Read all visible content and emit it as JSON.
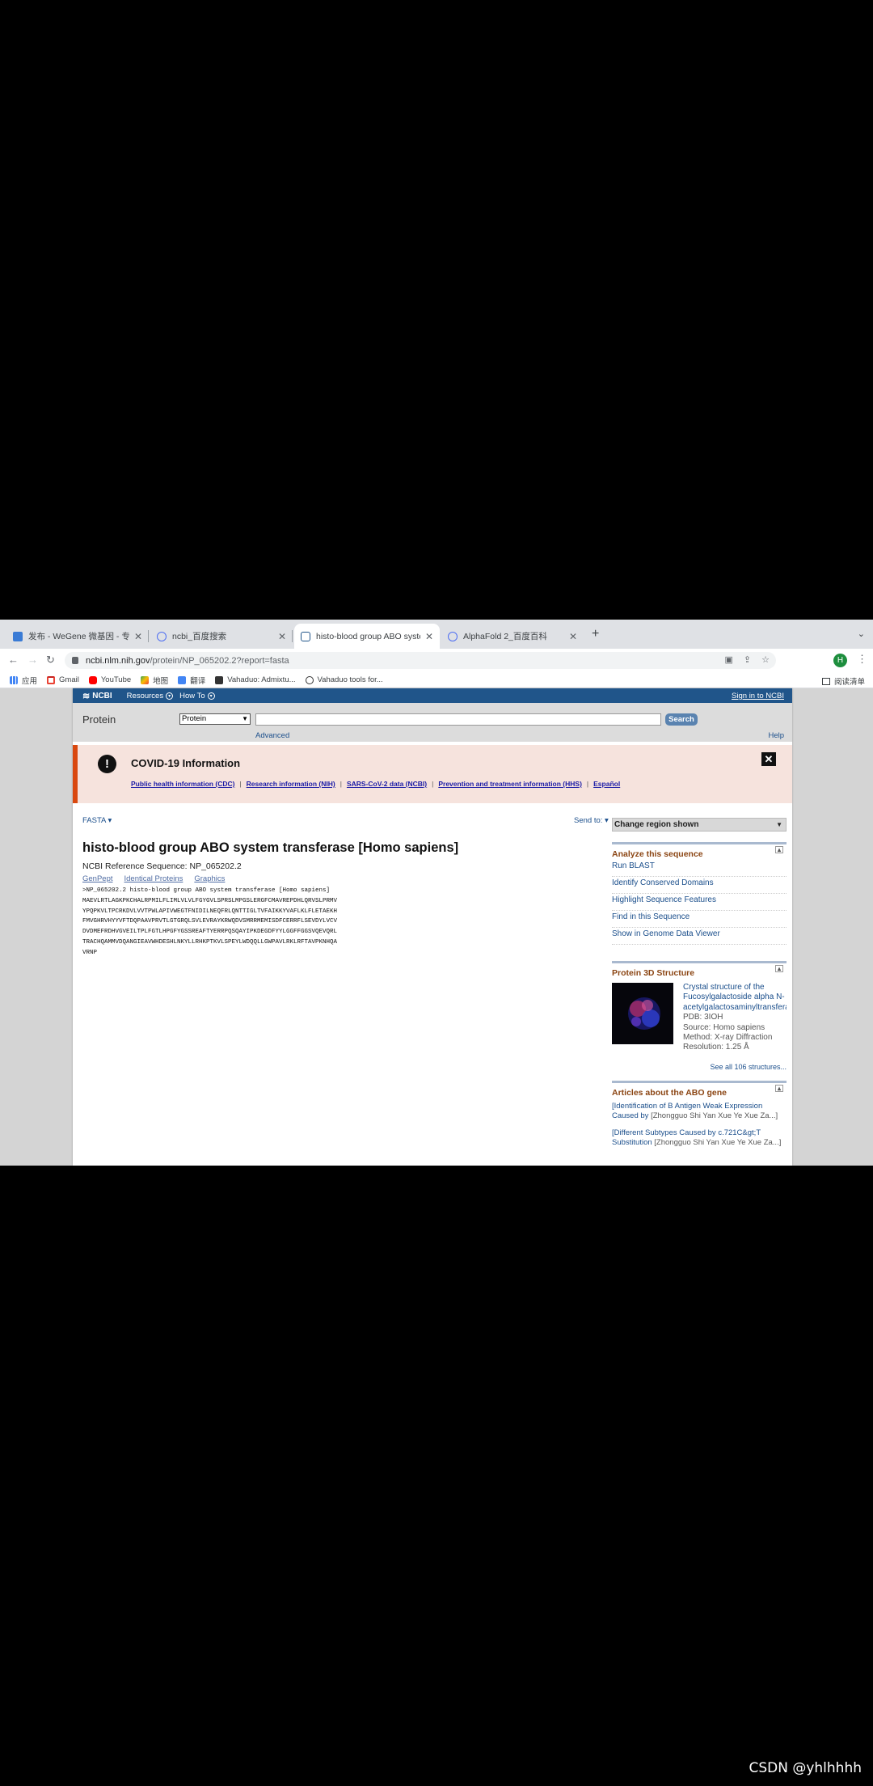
{
  "browser": {
    "tabs": [
      {
        "title": "发布 - WeGene 微基因 - 专注个",
        "active": false
      },
      {
        "title": "ncbi_百度搜索",
        "active": false
      },
      {
        "title": "histo-blood group ABO systen",
        "active": true
      },
      {
        "title": "AlphaFold 2_百度百科",
        "active": false
      }
    ],
    "url_host": "ncbi.nlm.nih.gov",
    "url_path": "/protein/NP_065202.2?report=fasta",
    "avatar": "H",
    "bookmarks": [
      "应用",
      "Gmail",
      "YouTube",
      "地图",
      "翻译",
      "Vahaduo: Admixtu...",
      "Vahaduo tools for..."
    ],
    "reading_list": "阅读清单",
    "colors": {
      "tabbar": "#dfe1e5",
      "ncbi_blue": "#20558a",
      "covid_bg": "#f6e3dd",
      "covid_accent": "#d9480f"
    }
  },
  "ncbi": {
    "logo": "NCBI",
    "resources": "Resources",
    "howto": "How To",
    "signin": "Sign in to NCBI",
    "db_title": "Protein",
    "db_selected": "Protein",
    "search_value": "",
    "search_btn": "Search",
    "advanced": "Advanced",
    "help": "Help",
    "covid": {
      "title": "COVID-19 Information",
      "links": [
        "Public health information (CDC)",
        "Research information (NIH)",
        "SARS-CoV-2 data (NCBI)",
        "Prevention and treatment information (HHS)",
        "Español"
      ]
    },
    "format_menu": "FASTA",
    "send_to": "Send to:",
    "record_title": "histo-blood group ABO system transferase [Homo sapiens]",
    "refseq": "NCBI Reference Sequence: NP_065202.2",
    "record_links": [
      "GenPept",
      "Identical Proteins",
      "Graphics"
    ],
    "fasta_lines": [
      ">NP_065202.2 histo-blood group ABO system transferase [Homo sapiens]",
      "MAEVLRTLAGKPKCHALRPMILFLIMLVLVLFGYGVLSPRSLMPGSLERGFCMAVREPDHLQRVSLPRMV",
      "YPQPKVLTPCRKDVLVVTPWLAPIVWEGTFNIDILNEQFRLQNTTIGLTVFAIKKYVAFLKLFLETAEKH",
      "FMVGHRVHYYVFTDQPAAVPRVTLGTGRQLSVLEVRAYKRWQDVSMRRMEMISDFCERRFLSEVDYLVCV",
      "DVDMEFRDHVGVEILTPLFGTLHPGFYGSSREAFTYERRPQSQAYIPKDEGDFYYLGGFFGGSVQEVQRL",
      "TRACHQAMMVDQANGIEAVWHDESHLNKYLLRHKPTKVLSPEYLWDQQLLGWPAVLRKLRFTAVPKNHQA",
      "VRNP"
    ],
    "sidebar": {
      "change_region": "Change region shown",
      "analyze_title": "Analyze this sequence",
      "analyze_links": [
        "Run BLAST",
        "Identify Conserved Domains",
        "Highlight Sequence Features",
        "Find in this Sequence",
        "Show in Genome Data Viewer"
      ],
      "structure_title": "Protein 3D Structure",
      "structure_name_1": "Crystal structure of the",
      "structure_name_2": "Fucosylgalactoside alpha N-",
      "structure_name_3": "acetylgalactosaminyltransfera",
      "pdb": "PDB: 3IOH",
      "source": "Source: Homo sapiens",
      "method": "Method: X-ray Diffraction",
      "resolution": "Resolution: 1.25 Å",
      "see_all": "See all 106 structures...",
      "articles_title": "Articles about the ABO gene",
      "articles": [
        {
          "line1": "[Identification of B Antigen Weak Expression",
          "line2_title": "Caused by",
          "authors": "[Zhongguo Shi Yan Xue Ye Xue Za...]"
        },
        {
          "line1": "[Different Subtypes Caused by c.721C&gt;T",
          "line2_title": "Substitution",
          "authors": "[Zhongguo Shi Yan Xue Ye Xue Za...]"
        }
      ]
    }
  },
  "watermark": "CSDN @yhlhhhh"
}
